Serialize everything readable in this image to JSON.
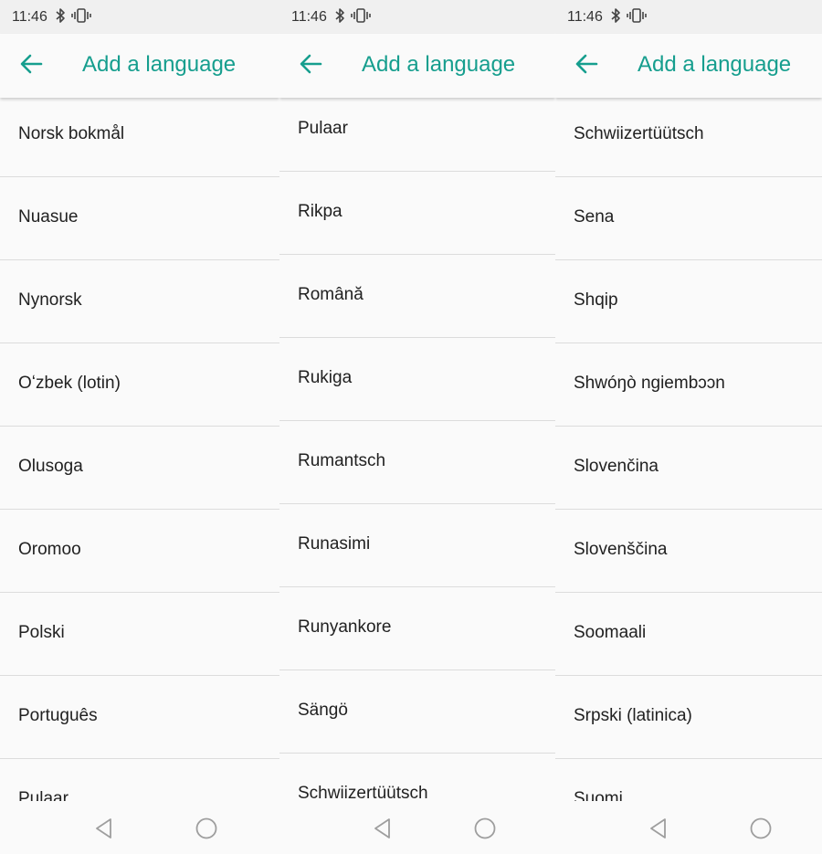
{
  "colors": {
    "accent": "#169e8e",
    "text": "#212121",
    "divider": "#dcdcdc",
    "status_bg": "#f0f0f0",
    "background": "#fafafa"
  },
  "screens": [
    {
      "status": {
        "time": "11:46",
        "icons": [
          "bluetooth-icon",
          "vibrate-icon"
        ]
      },
      "header": {
        "title": "Add a language",
        "back_icon": "arrow-back-icon"
      },
      "items": [
        {
          "label": "Norsk bokmål"
        },
        {
          "label": "Nuasue"
        },
        {
          "label": "Nynorsk"
        },
        {
          "label": "Oʻzbek (lotin)"
        },
        {
          "label": "Olusoga"
        },
        {
          "label": "Oromoo"
        },
        {
          "label": "Polski"
        },
        {
          "label": "Português"
        },
        {
          "label": "Pulaar"
        }
      ],
      "nav": [
        "back-triangle-icon",
        "home-circle-icon"
      ]
    },
    {
      "status": {
        "time": "11:46",
        "icons": [
          "bluetooth-icon",
          "vibrate-icon"
        ]
      },
      "header": {
        "title": "Add a language",
        "back_icon": "arrow-back-icon"
      },
      "items": [
        {
          "label": "Pulaar"
        },
        {
          "label": "Rikpa"
        },
        {
          "label": "Română"
        },
        {
          "label": "Rukiga"
        },
        {
          "label": "Rumantsch"
        },
        {
          "label": "Runasimi"
        },
        {
          "label": "Runyankore"
        },
        {
          "label": "Sängö"
        },
        {
          "label": "Schwiizertüütsch"
        }
      ],
      "nav": [
        "back-triangle-icon",
        "home-circle-icon"
      ]
    },
    {
      "status": {
        "time": "11:46",
        "icons": [
          "bluetooth-icon",
          "vibrate-icon"
        ]
      },
      "header": {
        "title": "Add a language",
        "back_icon": "arrow-back-icon"
      },
      "items": [
        {
          "label": "Schwiizertüütsch"
        },
        {
          "label": "Sena"
        },
        {
          "label": "Shqip"
        },
        {
          "label": "Shwóŋò ngiembɔɔn"
        },
        {
          "label": "Slovenčina"
        },
        {
          "label": "Slovenščina"
        },
        {
          "label": "Soomaali"
        },
        {
          "label": "Srpski (latinica)"
        },
        {
          "label": "Suomi"
        }
      ],
      "nav": [
        "back-triangle-icon",
        "home-circle-icon"
      ]
    }
  ]
}
